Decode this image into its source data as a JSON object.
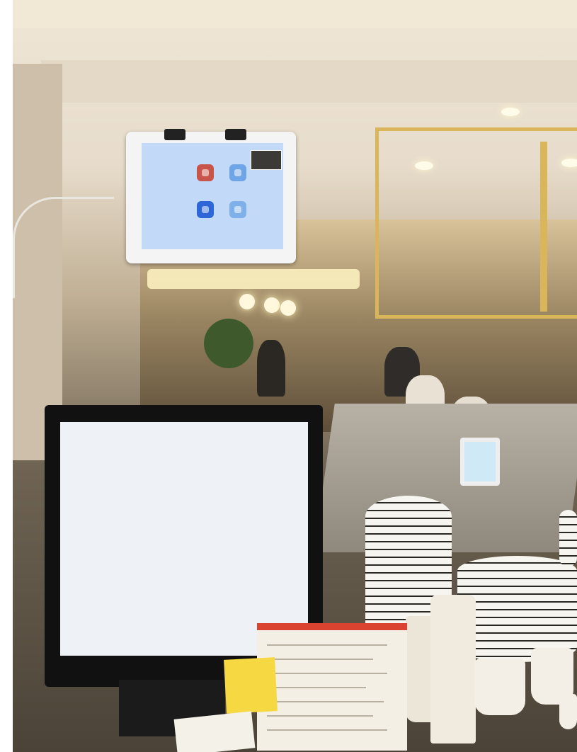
{
  "scene": {
    "setting": "restaurant-bar-counter",
    "colors": {
      "ceiling": "#f1e8d6",
      "gold_frame": "#d9b659",
      "tablet_screen": "#c2daf7",
      "monitor_screen": "#eef1f5",
      "menu_accent": "#d9432f",
      "sticky_note": "#f5d842"
    }
  },
  "tablet": {
    "apps": [
      {
        "icon": "app-icon-red",
        "color": "#c9554a"
      },
      {
        "icon": "app-icon-light-blue",
        "color": "#6ea5e6"
      },
      {
        "icon": "app-icon-blue",
        "color": "#2d66d6"
      },
      {
        "icon": "app-icon-light-blue",
        "color": "#7fb0ea"
      }
    ]
  }
}
